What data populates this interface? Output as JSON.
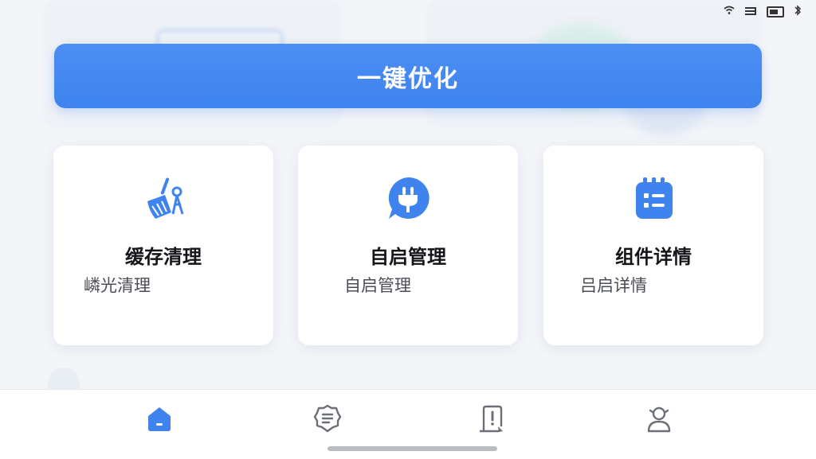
{
  "primary_action": {
    "label": "一键优化",
    "color": "#4189f0"
  },
  "cards": [
    {
      "title": "缓存清理",
      "subtitle": "嶙光清理",
      "icon": "broom-icon"
    },
    {
      "title": "自启管理",
      "subtitle": "自启管理",
      "icon": "power-plug-icon"
    },
    {
      "title": "组件详情",
      "subtitle": "吕启详情",
      "icon": "component-list-icon"
    }
  ],
  "bottom_nav": [
    {
      "name": "home",
      "icon": "home-icon",
      "active": true
    },
    {
      "name": "list",
      "icon": "list-badge-icon",
      "active": false
    },
    {
      "name": "report",
      "icon": "report-alert-icon",
      "active": false
    },
    {
      "name": "profile",
      "icon": "user-icon",
      "active": false
    }
  ],
  "colors": {
    "accent": "#3f83ef",
    "inactive_icon": "#6b6f78",
    "background": "#f3f5f9"
  }
}
